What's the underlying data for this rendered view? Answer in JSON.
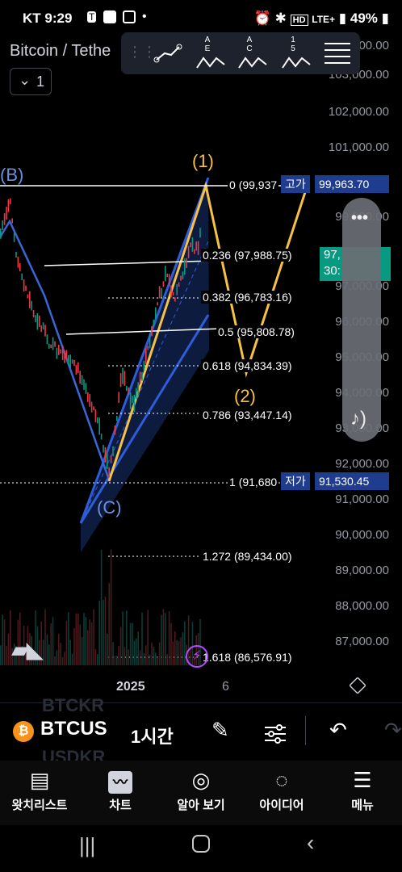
{
  "status_bar": {
    "carrier": "KT",
    "time": "9:29",
    "network": "LTE+",
    "battery": "49%"
  },
  "chart_header": {
    "title": "Bitcoin / Tethe",
    "timeframe_interval": "1"
  },
  "drawing_toolbar": {
    "tool_labels": [
      "",
      "A E",
      "A C",
      "1 5"
    ]
  },
  "price_axis": [
    "100,000.00",
    "103,000.00",
    "102,000.00",
    "101,000.00",
    "99,000.00",
    "98,000.00",
    "97,000.00",
    "96,000.00",
    "95,000.00",
    "94,000.00",
    "93,000.00",
    "92,000.00",
    "91,000.00",
    "90,000.00",
    "89,000.00",
    "88,000.00",
    "87,000.00"
  ],
  "fib_levels": [
    {
      "level": "0",
      "price": "(99,937"
    },
    {
      "level": "0.236",
      "price": "(97,988.75)"
    },
    {
      "level": "0.382",
      "price": "(96,783.16)"
    },
    {
      "level": "0.5",
      "price": "(95,808.78)"
    },
    {
      "level": "0.618",
      "price": "(94,834.39)"
    },
    {
      "level": "0.786",
      "price": "(93,447.14)"
    },
    {
      "level": "1",
      "price": "(91,680"
    },
    {
      "level": "1.272",
      "price": "(89,434.00)"
    },
    {
      "level": "1.618",
      "price": "(86,576.91)"
    }
  ],
  "wave_labels": {
    "b": "(B)",
    "c": "(C)",
    "w1": "(1)",
    "w2": "(2)"
  },
  "price_tags": {
    "high_label": "고가",
    "high_value": "99,963.70",
    "current_value": "97,",
    "current_sub": "30:",
    "low_label": "저가",
    "low_value": "91,530.45"
  },
  "time_axis": {
    "year": "2025",
    "next": "6"
  },
  "symbol_bar": {
    "symbol": "BTCUS",
    "interval": "1시간",
    "ghost_top": "BTCKR",
    "ghost_bottom": "USDKR"
  },
  "bottom_nav": [
    {
      "label": "왓치리스트"
    },
    {
      "label": "차트"
    },
    {
      "label": "알아 보기"
    },
    {
      "label": "아이디어"
    },
    {
      "label": "메뉴"
    }
  ],
  "colors": {
    "fib_blue": "#2f5cd8",
    "wave_yellow": "#f7c244",
    "accent": "#2962ff",
    "green": "#089981",
    "purple": "#b24dff"
  }
}
